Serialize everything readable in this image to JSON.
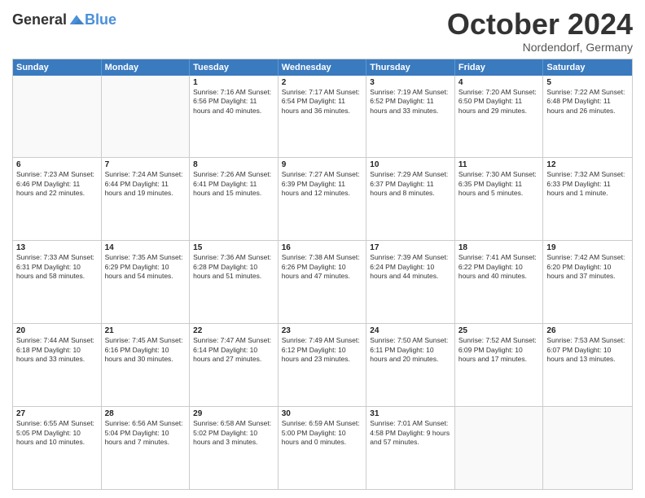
{
  "header": {
    "logo_general": "General",
    "logo_blue": "Blue",
    "month": "October 2024",
    "location": "Nordendorf, Germany"
  },
  "days": [
    "Sunday",
    "Monday",
    "Tuesday",
    "Wednesday",
    "Thursday",
    "Friday",
    "Saturday"
  ],
  "weeks": [
    [
      {
        "date": "",
        "info": ""
      },
      {
        "date": "",
        "info": ""
      },
      {
        "date": "1",
        "info": "Sunrise: 7:16 AM\nSunset: 6:56 PM\nDaylight: 11 hours and 40 minutes."
      },
      {
        "date": "2",
        "info": "Sunrise: 7:17 AM\nSunset: 6:54 PM\nDaylight: 11 hours and 36 minutes."
      },
      {
        "date": "3",
        "info": "Sunrise: 7:19 AM\nSunset: 6:52 PM\nDaylight: 11 hours and 33 minutes."
      },
      {
        "date": "4",
        "info": "Sunrise: 7:20 AM\nSunset: 6:50 PM\nDaylight: 11 hours and 29 minutes."
      },
      {
        "date": "5",
        "info": "Sunrise: 7:22 AM\nSunset: 6:48 PM\nDaylight: 11 hours and 26 minutes."
      }
    ],
    [
      {
        "date": "6",
        "info": "Sunrise: 7:23 AM\nSunset: 6:46 PM\nDaylight: 11 hours and 22 minutes."
      },
      {
        "date": "7",
        "info": "Sunrise: 7:24 AM\nSunset: 6:44 PM\nDaylight: 11 hours and 19 minutes."
      },
      {
        "date": "8",
        "info": "Sunrise: 7:26 AM\nSunset: 6:41 PM\nDaylight: 11 hours and 15 minutes."
      },
      {
        "date": "9",
        "info": "Sunrise: 7:27 AM\nSunset: 6:39 PM\nDaylight: 11 hours and 12 minutes."
      },
      {
        "date": "10",
        "info": "Sunrise: 7:29 AM\nSunset: 6:37 PM\nDaylight: 11 hours and 8 minutes."
      },
      {
        "date": "11",
        "info": "Sunrise: 7:30 AM\nSunset: 6:35 PM\nDaylight: 11 hours and 5 minutes."
      },
      {
        "date": "12",
        "info": "Sunrise: 7:32 AM\nSunset: 6:33 PM\nDaylight: 11 hours and 1 minute."
      }
    ],
    [
      {
        "date": "13",
        "info": "Sunrise: 7:33 AM\nSunset: 6:31 PM\nDaylight: 10 hours and 58 minutes."
      },
      {
        "date": "14",
        "info": "Sunrise: 7:35 AM\nSunset: 6:29 PM\nDaylight: 10 hours and 54 minutes."
      },
      {
        "date": "15",
        "info": "Sunrise: 7:36 AM\nSunset: 6:28 PM\nDaylight: 10 hours and 51 minutes."
      },
      {
        "date": "16",
        "info": "Sunrise: 7:38 AM\nSunset: 6:26 PM\nDaylight: 10 hours and 47 minutes."
      },
      {
        "date": "17",
        "info": "Sunrise: 7:39 AM\nSunset: 6:24 PM\nDaylight: 10 hours and 44 minutes."
      },
      {
        "date": "18",
        "info": "Sunrise: 7:41 AM\nSunset: 6:22 PM\nDaylight: 10 hours and 40 minutes."
      },
      {
        "date": "19",
        "info": "Sunrise: 7:42 AM\nSunset: 6:20 PM\nDaylight: 10 hours and 37 minutes."
      }
    ],
    [
      {
        "date": "20",
        "info": "Sunrise: 7:44 AM\nSunset: 6:18 PM\nDaylight: 10 hours and 33 minutes."
      },
      {
        "date": "21",
        "info": "Sunrise: 7:45 AM\nSunset: 6:16 PM\nDaylight: 10 hours and 30 minutes."
      },
      {
        "date": "22",
        "info": "Sunrise: 7:47 AM\nSunset: 6:14 PM\nDaylight: 10 hours and 27 minutes."
      },
      {
        "date": "23",
        "info": "Sunrise: 7:49 AM\nSunset: 6:12 PM\nDaylight: 10 hours and 23 minutes."
      },
      {
        "date": "24",
        "info": "Sunrise: 7:50 AM\nSunset: 6:11 PM\nDaylight: 10 hours and 20 minutes."
      },
      {
        "date": "25",
        "info": "Sunrise: 7:52 AM\nSunset: 6:09 PM\nDaylight: 10 hours and 17 minutes."
      },
      {
        "date": "26",
        "info": "Sunrise: 7:53 AM\nSunset: 6:07 PM\nDaylight: 10 hours and 13 minutes."
      }
    ],
    [
      {
        "date": "27",
        "info": "Sunrise: 6:55 AM\nSunset: 5:05 PM\nDaylight: 10 hours and 10 minutes."
      },
      {
        "date": "28",
        "info": "Sunrise: 6:56 AM\nSunset: 5:04 PM\nDaylight: 10 hours and 7 minutes."
      },
      {
        "date": "29",
        "info": "Sunrise: 6:58 AM\nSunset: 5:02 PM\nDaylight: 10 hours and 3 minutes."
      },
      {
        "date": "30",
        "info": "Sunrise: 6:59 AM\nSunset: 5:00 PM\nDaylight: 10 hours and 0 minutes."
      },
      {
        "date": "31",
        "info": "Sunrise: 7:01 AM\nSunset: 4:58 PM\nDaylight: 9 hours and 57 minutes."
      },
      {
        "date": "",
        "info": ""
      },
      {
        "date": "",
        "info": ""
      }
    ]
  ]
}
